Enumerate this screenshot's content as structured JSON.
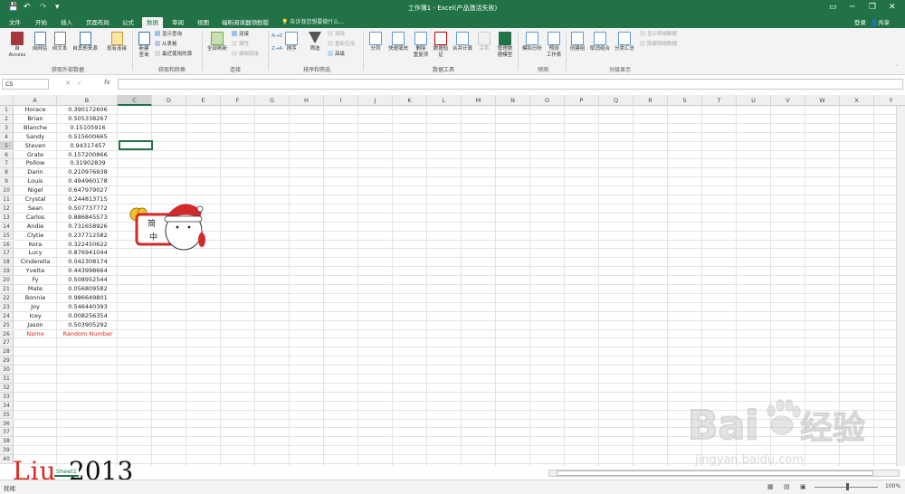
{
  "titlebar": {
    "title": "工作簿1 - Excel(产品激活失败)"
  },
  "ribbon_tabs": [
    "文件",
    "开始",
    "插入",
    "页面布局",
    "公式",
    "数据",
    "审阅",
    "视图",
    "福昕阅读器领鲜版"
  ],
  "active_tab": "数据",
  "tell_me": "告诉我您想要做什么...",
  "signin": "登录",
  "share": "共享",
  "ribbon": {
    "get_external": [
      "自 Access",
      "自网站",
      "自文本",
      "自其他来源",
      "现有连接"
    ],
    "get_external_group": "获取外部数据",
    "new_query": "新建\n查询",
    "transform_items": [
      "显示查询",
      "从表格",
      "最近使用的源"
    ],
    "transform_group": "获取和转换",
    "refresh_all": "全部刷新",
    "connections_items": [
      "连接",
      "属性",
      "编辑链接"
    ],
    "connections_group": "连接",
    "sort_az": "A→Z",
    "sort_za": "Z→A",
    "sort": "排序",
    "filter": "筛选",
    "filter_items": [
      "清除",
      "重新应用",
      "高级"
    ],
    "sort_group": "排序和筛选",
    "data_tools": [
      "分列",
      "快速填充",
      "删除\n重复项",
      "数据验\n证",
      "合并计算",
      "关系",
      "管理数\n据模型"
    ],
    "data_tools_group": "数据工具",
    "forecast": [
      "模拟分析",
      "预测\n工作表"
    ],
    "forecast_group": "预测",
    "outline": [
      "创建组",
      "取消组合",
      "分类汇总"
    ],
    "outline_items": [
      "显示明细数据",
      "隐藏明细数据"
    ],
    "outline_group": "分级显示"
  },
  "name_box": "C5",
  "formula_bar_buttons": [
    "✕",
    "✓"
  ],
  "fx_label": "fx",
  "columns": [
    "A",
    "B",
    "C",
    "D",
    "E",
    "F",
    "G",
    "H",
    "I",
    "J",
    "K",
    "L",
    "M",
    "N",
    "O",
    "P",
    "Q",
    "R",
    "S",
    "T",
    "U",
    "V",
    "W",
    "X",
    "Y"
  ],
  "selected_column": "C",
  "selected_row": 5,
  "row_count": 40,
  "names": [
    "Horace",
    "Brian",
    "Blanche",
    "Sandy",
    "Steven",
    "Grate",
    "Pollow",
    "Darin",
    "Louis",
    "Nigel",
    "Crystal",
    "Sean",
    "Carlos",
    "Andie",
    "Clytie",
    "Kora",
    "Lucy",
    "Cinderella",
    "Yvette",
    "Fy",
    "Mate",
    "Bonnie",
    "Joy",
    "Icey",
    "Jason"
  ],
  "random_numbers": [
    "0.390172606",
    "0.505338267",
    "0.15105916",
    "0.515600665",
    "0.94317457",
    "0.157200866",
    "0.31902839",
    "0.210976938",
    "0.494960178",
    "0.647979027",
    "0.244813715",
    "0.507737772",
    "0.886845573",
    "0.731658926",
    "0.237712582",
    "0.322450622",
    "0.876941044",
    "0.042308174",
    "0.443998664",
    "0.508952544",
    "0.056809582",
    "0.986649801",
    "0.546440393",
    "0.008256354",
    "0.503905292"
  ],
  "header_row": {
    "name": "Name",
    "number": "Random Number"
  },
  "sticker": {
    "line1": "简",
    "line2": "中"
  },
  "sheet_tab": "Sheet1",
  "status": "就绪",
  "zoom": "100%",
  "logo_text": {
    "part1": "Liu",
    "part2": "2013"
  },
  "watermark": {
    "text1": "Bai",
    "text2": "经验",
    "url": "jingyan.baidu.com"
  },
  "colors": {
    "excel_green": "#217346",
    "accent_red": "#e0271f"
  }
}
